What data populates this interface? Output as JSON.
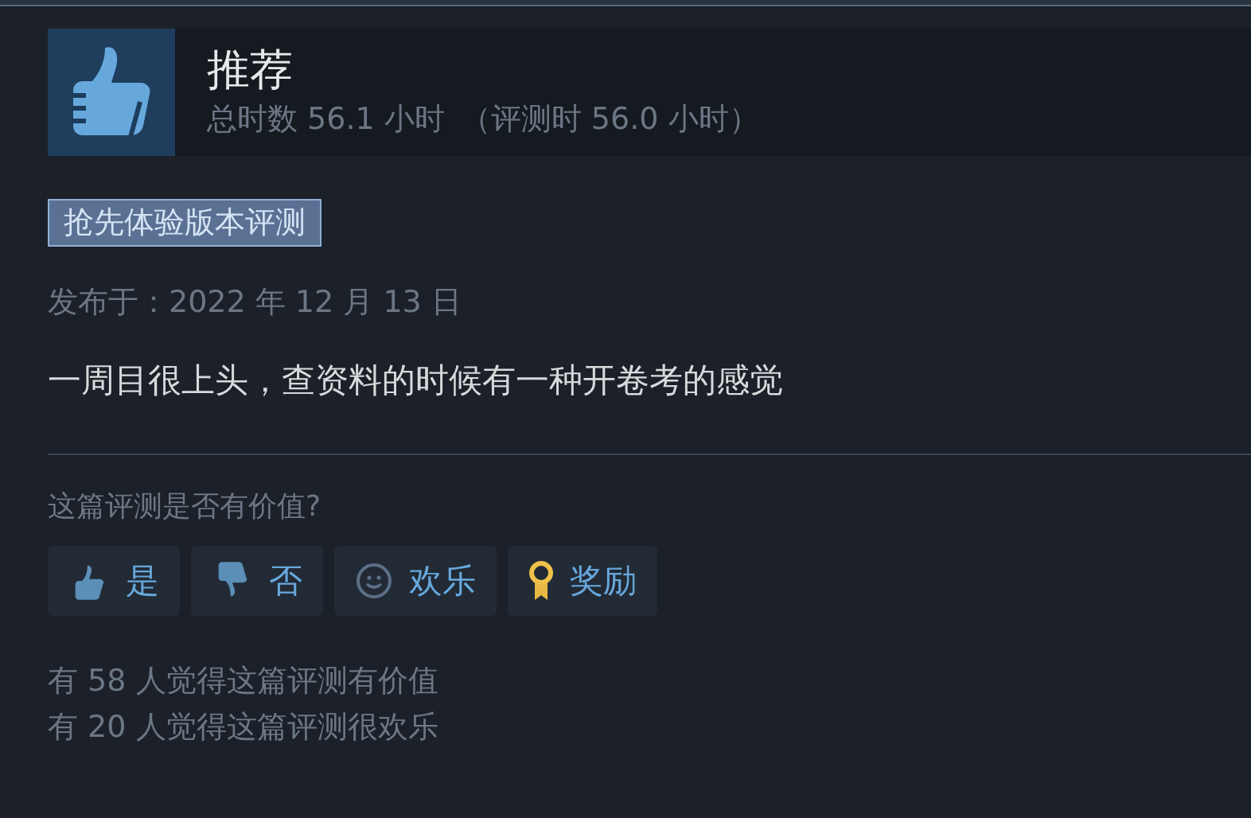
{
  "review": {
    "verdict": "推荐",
    "playtime": "总时数 56.1 小时",
    "playtime_at_review": "（评测时 56.0 小时）",
    "tag": "抢先体验版本评测",
    "posted": "发布于：2022 年 12 月 13 日",
    "text": "一周目很上头，查资料的时候有一种开卷考的感觉"
  },
  "feedback": {
    "question": "这篇评测是否有价值?",
    "buttons": [
      {
        "kind": "up",
        "label": "是"
      },
      {
        "kind": "down",
        "label": "否"
      },
      {
        "kind": "funny",
        "label": "欢乐"
      },
      {
        "kind": "award",
        "label": "奖励"
      }
    ],
    "counts": [
      "有 58 人觉得这篇评测有价值",
      "有 20 人觉得这篇评测很欢乐"
    ]
  }
}
